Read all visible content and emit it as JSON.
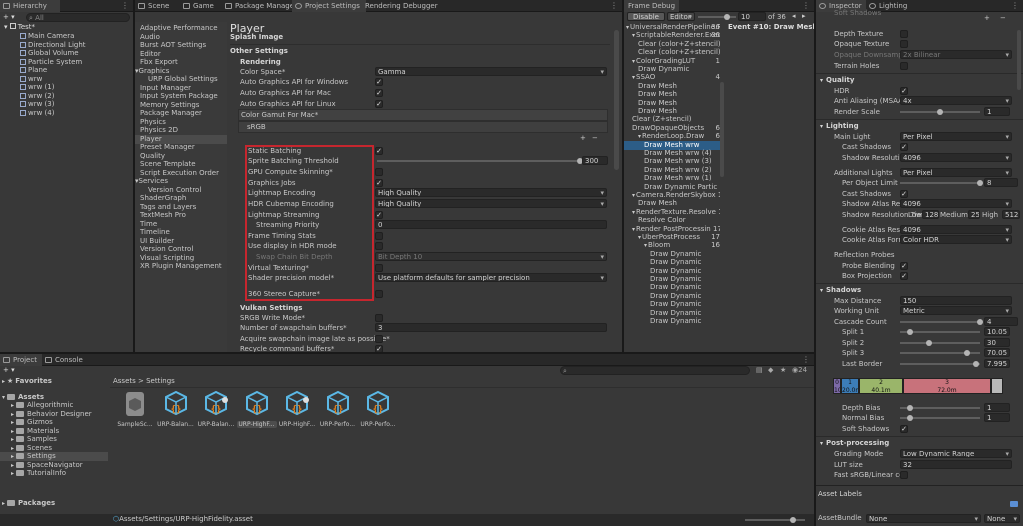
{
  "toolbar": {
    "add": "+ ▾",
    "search_placeholder": "All"
  },
  "tabs": {
    "hierarchy": "Hierarchy",
    "scene": "Scene",
    "game": "Game",
    "package_manager": "Package Manager",
    "project_settings": "Project Settings",
    "rendering_debugger": "Rendering Debugger",
    "frame_debug": "Frame Debug",
    "inspector": "Inspector",
    "lighting": "Lighting",
    "project": "Project",
    "console": "Console"
  },
  "hierarchy": {
    "scene": "Test*",
    "items": [
      "Main Camera",
      "Directional Light",
      "Global Volume",
      "Particle System",
      "Plane",
      "wrw",
      "wrw (1)",
      "wrw (2)",
      "wrw (3)",
      "wrw (4)"
    ]
  },
  "settings_nav": [
    {
      "label": "Adaptive Performance",
      "indent": 0
    },
    {
      "label": "Audio",
      "indent": 0
    },
    {
      "label": "Burst AOT Settings",
      "indent": 0
    },
    {
      "label": "Editor",
      "indent": 0
    },
    {
      "label": "Fbx Export",
      "indent": 0
    },
    {
      "label": "Graphics",
      "indent": 0,
      "fold": true
    },
    {
      "label": "URP Global Settings",
      "indent": 1
    },
    {
      "label": "Input Manager",
      "indent": 0
    },
    {
      "label": "Input System Package",
      "indent": 0
    },
    {
      "label": "Memory Settings",
      "indent": 0
    },
    {
      "label": "Package Manager",
      "indent": 0
    },
    {
      "label": "Physics",
      "indent": 0
    },
    {
      "label": "Physics 2D",
      "indent": 0
    },
    {
      "label": "Player",
      "indent": 0,
      "selected": true
    },
    {
      "label": "Preset Manager",
      "indent": 0
    },
    {
      "label": "Quality",
      "indent": 0
    },
    {
      "label": "Scene Template",
      "indent": 0
    },
    {
      "label": "Script Execution Order",
      "indent": 0
    },
    {
      "label": "Services",
      "indent": 0,
      "fold": true
    },
    {
      "label": "Version Control",
      "indent": 1
    },
    {
      "label": "ShaderGraph",
      "indent": 0
    },
    {
      "label": "Tags and Layers",
      "indent": 0
    },
    {
      "label": "TextMesh Pro",
      "indent": 0
    },
    {
      "label": "Time",
      "indent": 0
    },
    {
      "label": "Timeline",
      "indent": 0
    },
    {
      "label": "UI Builder",
      "indent": 0
    },
    {
      "label": "Version Control",
      "indent": 0
    },
    {
      "label": "Visual Scripting",
      "indent": 0
    },
    {
      "label": "XR Plugin Management",
      "indent": 0
    }
  ],
  "player": {
    "title": "Player",
    "splash": "Splash Image",
    "other": "Other Settings",
    "rendering": "Rendering",
    "color_space_label": "Color Space*",
    "color_space": "Gamma",
    "auto_win": "Auto Graphics API  for Windows",
    "auto_mac": "Auto Graphics API  for Mac",
    "auto_linux": "Auto Graphics API  for Linux",
    "gamut": "Color Gamut For Mac*",
    "srgb": "sRGB",
    "static_batching": "Static Batching",
    "sprite_threshold": "Sprite Batching Threshold",
    "sprite_value": "300",
    "gpu_skinning": "GPU Compute Skinning*",
    "graphics_jobs": "Graphics Jobs",
    "lightmap_enc": "Lightmap Encoding",
    "lightmap_enc_val": "High Quality",
    "hdr_cube": "HDR Cubemap Encoding",
    "hdr_cube_val": "High Quality",
    "lm_streaming": "Lightmap Streaming",
    "stream_prio": "Streaming Priority",
    "stream_prio_val": "0",
    "frame_timing": "Frame Timing Stats",
    "hdr_display": "Use display in HDR mode",
    "swap_depth": "Swap Chain Bit Depth",
    "swap_depth_val": "Bit Depth 10",
    "virtual_tex": "Virtual Texturing*",
    "shader_prec": "Shader precision model*",
    "shader_prec_val": "Use platform defaults for sampler precision",
    "stereo": "360 Stereo Capture*",
    "vulkan": "Vulkan Settings",
    "srgb_write": "SRGB Write Mode*",
    "swapchain": "Number of swapchain buffers*",
    "swapchain_val": "3",
    "acquire": "Acquire swapchain image late as possible*",
    "recycle": "Recycle command buffers*"
  },
  "frame_debug": {
    "disable": "Disable",
    "editor": "Editor",
    "event_num": "10",
    "of": "of 36",
    "event_title": "Event #10: Draw Mesh",
    "tree": [
      {
        "t": "UniversalRenderPipeline.R",
        "c": "36",
        "i": 0
      },
      {
        "t": "ScriptableRenderer.Exec",
        "c": "36",
        "i": 1
      },
      {
        "t": "Clear (color+Z+stencil)",
        "c": "",
        "i": 2
      },
      {
        "t": "Clear (color+Z+stencil)",
        "c": "",
        "i": 2
      },
      {
        "t": "ColorGradingLUT",
        "c": "1",
        "i": 1
      },
      {
        "t": "Draw Dynamic",
        "c": "",
        "i": 2
      },
      {
        "t": "SSAO",
        "c": "4",
        "i": 1
      },
      {
        "t": "Draw Mesh",
        "c": "",
        "i": 2
      },
      {
        "t": "Draw Mesh",
        "c": "",
        "i": 2
      },
      {
        "t": "Draw Mesh",
        "c": "",
        "i": 2
      },
      {
        "t": "Draw Mesh",
        "c": "",
        "i": 2
      },
      {
        "t": "Clear (Z+stencil)",
        "c": "",
        "i": 1
      },
      {
        "t": "DrawOpaqueObjects",
        "c": "6",
        "i": 1
      },
      {
        "t": "RenderLoop.Draw",
        "c": "6",
        "i": 2
      },
      {
        "t": "Draw Mesh wrw",
        "c": "",
        "i": 3,
        "sel": true
      },
      {
        "t": "Draw Mesh wrw (4)",
        "c": "",
        "i": 3
      },
      {
        "t": "Draw Mesh wrw (3)",
        "c": "",
        "i": 3
      },
      {
        "t": "Draw Mesh wrw (2)",
        "c": "",
        "i": 3
      },
      {
        "t": "Draw Mesh wrw (1)",
        "c": "",
        "i": 3
      },
      {
        "t": "Draw Dynamic Partic",
        "c": "",
        "i": 3
      },
      {
        "t": "Camera.RenderSkybox 1",
        "c": "",
        "i": 1
      },
      {
        "t": "Draw Mesh",
        "c": "",
        "i": 2
      },
      {
        "t": "RenderTexture.Resolve 1",
        "c": "",
        "i": 1
      },
      {
        "t": "Resolve Color",
        "c": "",
        "i": 2
      },
      {
        "t": "Render PostProcessin 17",
        "c": "",
        "i": 1
      },
      {
        "t": "UberPostProcess",
        "c": "17",
        "i": 2
      },
      {
        "t": "Bloom",
        "c": "16",
        "i": 3
      },
      {
        "t": "Draw Dynamic",
        "c": "",
        "i": 4
      },
      {
        "t": "Draw Dynamic",
        "c": "",
        "i": 4
      },
      {
        "t": "Draw Dynamic",
        "c": "",
        "i": 4
      },
      {
        "t": "Draw Dynamic",
        "c": "",
        "i": 4
      },
      {
        "t": "Draw Dynamic",
        "c": "",
        "i": 4
      },
      {
        "t": "Draw Dynamic",
        "c": "",
        "i": 4
      },
      {
        "t": "Draw Dynamic",
        "c": "",
        "i": 4
      },
      {
        "t": "Draw Dynamic",
        "c": "",
        "i": 4
      },
      {
        "t": "Draw Dynamic",
        "c": "",
        "i": 4
      }
    ]
  },
  "inspector": {
    "partial_top": "Soft Shadows",
    "depth_tex": "Depth Texture",
    "opaque_tex": "Opaque Texture",
    "opaque_down": "Opaque Downsampling",
    "opaque_down_val": "2x Bilinear",
    "terrain_holes": "Terrain Holes",
    "quality": "Quality",
    "hdr": "HDR",
    "msaa": "Anti Aliasing (MSAA)",
    "msaa_val": "4x",
    "render_scale": "Render Scale",
    "render_scale_val": "1",
    "lighting": "Lighting",
    "main_light": "Main Light",
    "main_light_val": "Per Pixel",
    "cast_shadows": "Cast Shadows",
    "shadow_res": "Shadow Resolution",
    "shadow_res_val": "4096",
    "add_lights": "Additional Lights",
    "add_lights_val": "Per Pixel",
    "per_obj": "Per Object Limit",
    "per_obj_val": "8",
    "cast_shadows2": "Cast Shadows",
    "atlas_res": "Shadow Atlas Resol",
    "atlas_res_val": "4096",
    "tiers": "Shadow Resolution Tiers",
    "low": "Low",
    "low_val": "128",
    "med": "Medium",
    "med_val": "256",
    "high": "High",
    "high_val": "512",
    "cookie_res": "Cookie Atlas Resolut",
    "cookie_res_val": "4096",
    "cookie_fmt": "Cookie Atlas Format",
    "cookie_fmt_val": "Color HDR",
    "refl": "Reflection Probes",
    "probe_blend": "Probe Blending",
    "box_proj": "Box Projection",
    "shadows": "Shadows",
    "max_dist": "Max Distance",
    "max_dist_val": "150",
    "work_unit": "Working Unit",
    "work_unit_val": "Metric",
    "cascade": "Cascade Count",
    "cascade_val": "4",
    "split1": "Split 1",
    "split1_val": "10.05",
    "split2": "Split 2",
    "split2_val": "30",
    "split3": "Split 3",
    "split3_val": "70.05",
    "last_border": "Last Border",
    "last_border_val": "7.995",
    "cascades": [
      {
        "n": "0",
        "d": "10.1"
      },
      {
        "n": "1",
        "d": "20.0m"
      },
      {
        "n": "2",
        "d": "40.1m"
      },
      {
        "n": "3",
        "d": "72.0m"
      },
      {
        "n": "",
        "d": ""
      }
    ],
    "depth_bias": "Depth Bias",
    "depth_bias_val": "1",
    "normal_bias": "Normal Bias",
    "normal_bias_val": "1",
    "soft_shadows": "Soft Shadows",
    "post": "Post-processing",
    "grading": "Grading Mode",
    "grading_val": "Low Dynamic Range",
    "lut": "LUT size",
    "lut_val": "32",
    "fast_srgb": "Fast sRGB/Linear con",
    "asset_labels": "Asset Labels",
    "asset_bundle": "AssetBundle",
    "bundle_val": "None",
    "variant_val": "None"
  },
  "project": {
    "favorites": "Favorites",
    "assets": "Assets",
    "folders": [
      "Allegorithmic",
      "Behavior Designer",
      "Gizmos",
      "Materials",
      "Samples",
      "Scenes",
      "Settings",
      "SpaceNavigator",
      "TutorialInfo"
    ],
    "packages": "Packages",
    "breadcrumb": "Assets > Settings",
    "hidden_count": "24",
    "items": [
      "SampleSc...",
      "URP-Balan...",
      "URP-Balan...",
      "URP-HighF...",
      "URP-HighF...",
      "URP-Perfo...",
      "URP-Perfo..."
    ],
    "status_path": "Assets/Settings/URP-HighFidelity.asset"
  },
  "colors": {
    "accent": "#2c5d87",
    "highlight": "#c6262e",
    "cyan": "#5bb8e6",
    "orange": "#e8831a"
  }
}
